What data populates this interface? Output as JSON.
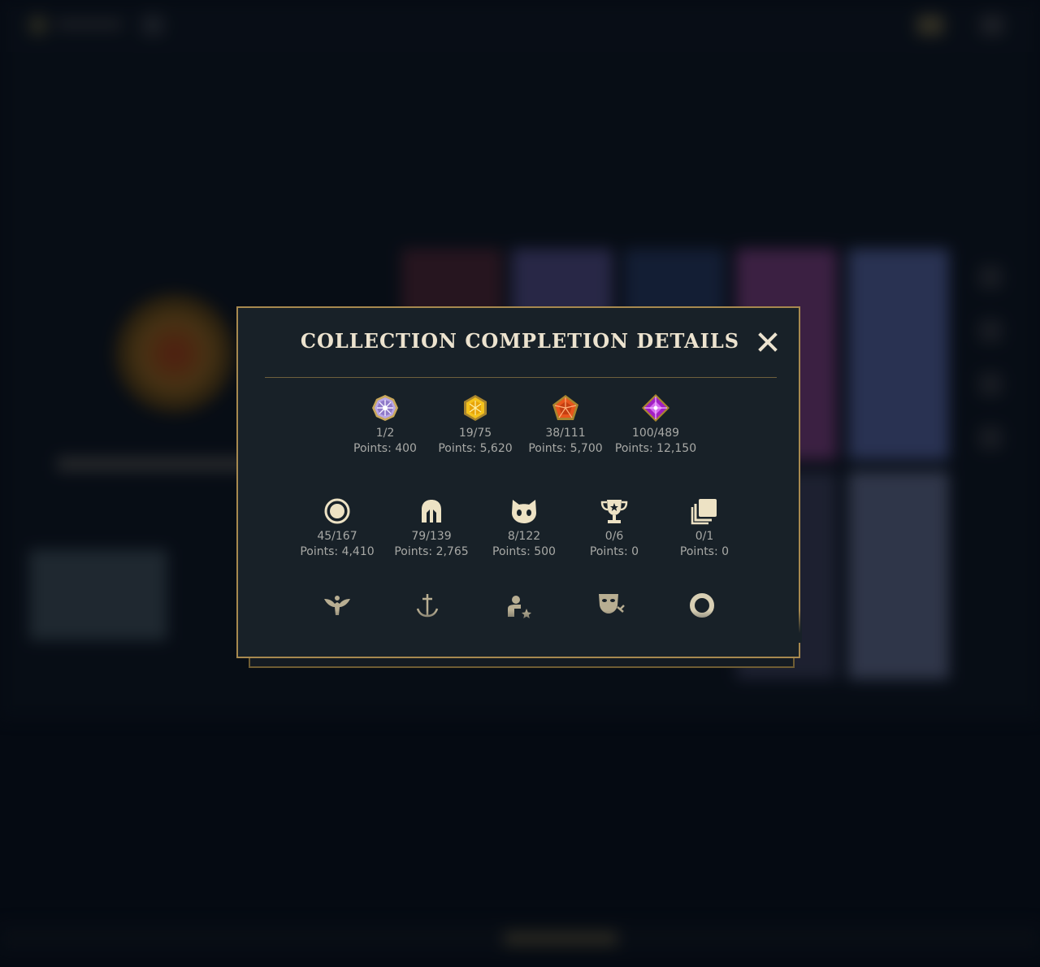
{
  "modal": {
    "title": "COLLECTION COMPLETION DETAILS",
    "close_icon": "close-icon"
  },
  "colors": {
    "gold_border": "#a7894f",
    "title_text": "#ece3cf",
    "stat_text": "#a8a9a6",
    "icon_cream": "#ede2c4",
    "panel_bg": "#182128"
  },
  "gem_stats": [
    {
      "icon": "crystal-gem-icon",
      "count": "1/2",
      "points": "Points: 400"
    },
    {
      "icon": "gold-gem-icon",
      "count": "19/75",
      "points": "Points: 5,620"
    },
    {
      "icon": "orange-gem-icon",
      "count": "38/111",
      "points": "Points: 5,700"
    },
    {
      "icon": "purple-gem-icon",
      "count": "100/489",
      "points": "Points: 12,150"
    }
  ],
  "category_stats": [
    {
      "icon": "ring-icon",
      "count": "45/167",
      "points": "Points: 4,410"
    },
    {
      "icon": "helmet-icon",
      "count": "79/139",
      "points": "Points: 2,765"
    },
    {
      "icon": "creature-icon",
      "count": "8/122",
      "points": "Points: 500"
    },
    {
      "icon": "trophy-icon",
      "count": "0/6",
      "points": "Points: 0"
    },
    {
      "icon": "cards-icon",
      "count": "0/1",
      "points": "Points: 0"
    }
  ],
  "more_icons": [
    "winged-emblem-icon",
    "anchor-icon",
    "player-star-icon",
    "mask-icon",
    "circle-outline-icon"
  ]
}
